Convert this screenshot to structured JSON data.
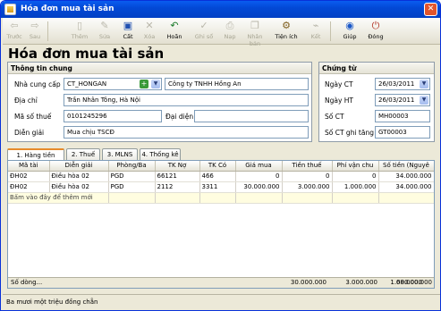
{
  "window": {
    "title": "Hóa đơn mua tài sản"
  },
  "toolbar": {
    "back": "Trước",
    "next": "Sau",
    "add": "Thêm",
    "edit": "Sửa",
    "delete": "Xóa",
    "save": "Cất",
    "post": "Ghi sổ",
    "undo": "Hoãn",
    "search": "Tìm kiếm",
    "print": "Nạp",
    "copy": "Nhân bản",
    "utilities": "Tiện ích",
    "attach": "Kết",
    "help": "Giúp",
    "close": "Đóng"
  },
  "page_title": "Hóa đơn mua tài sản",
  "general": {
    "header": "Thông tin chung",
    "supplier_label": "Nhà cung cấp",
    "supplier_code": "CT_HONGAN",
    "supplier_name": "Công ty TNHH Hồng An",
    "address_label": "Địa chỉ",
    "address": "Trần Nhân Tông, Hà Nội",
    "tax_label": "Mã số thuế",
    "tax_code": "0101245296",
    "rep_label": "Đại diện",
    "rep": "",
    "desc_label": "Diễn giải",
    "desc": "Mua chịu TSCĐ"
  },
  "voucher": {
    "header": "Chứng từ",
    "date_ct_label": "Ngày CT",
    "date_ct": "26/03/2011",
    "date_ht_label": "Ngày HT",
    "date_ht": "26/03/2011",
    "no_label": "Số CT",
    "no": "MH00003",
    "rec_label": "Số CT ghi tăng",
    "rec_no": "GT00003"
  },
  "tabs": [
    {
      "label": "1. Hàng tiền"
    },
    {
      "label": "2. Thuế"
    },
    {
      "label": "3. MLNS"
    },
    {
      "label": "4. Thống kê"
    }
  ],
  "grid": {
    "columns": [
      "Mã tài",
      "Diễn giải",
      "Phòng/Ba",
      "TK Nợ",
      "TK Có",
      "Giá mua",
      "Tiền thuế",
      "Phí vận chu",
      "Số tiền (Nguyê"
    ],
    "rows": [
      [
        "ĐH02",
        "Điều hòa 02",
        "PGD",
        "66121",
        "466",
        "0",
        "0",
        "0",
        "34.000.000"
      ],
      [
        "ĐH02",
        "Điều hòa 02",
        "PGD",
        "2112",
        "3311",
        "30.000.000",
        "3.000.000",
        "1.000.000",
        "34.000.000"
      ]
    ],
    "new_row_hint": "Bấm vào đây để thêm mới",
    "summary": {
      "label": "Số dòng...",
      "gia_mua": "30.000.000",
      "tien_thue": "3.000.000",
      "phi": "1.000.000",
      "so_tien": "68.000.000"
    }
  },
  "status_text": "Ba mươi một triệu đồng chẵn"
}
